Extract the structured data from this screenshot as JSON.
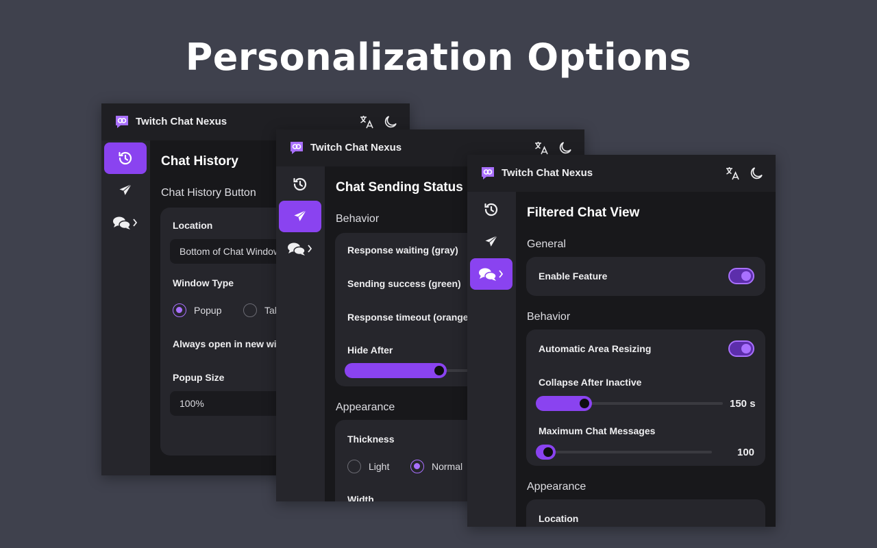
{
  "headline": "Personalization Options",
  "colors": {
    "accent": "#8a43f0",
    "accent_light": "#a970ff",
    "background": "#3f414d",
    "panel": "#18181b"
  },
  "app": {
    "name": "Twitch Chat Nexus",
    "icons": [
      "translate-icon",
      "moon-icon"
    ]
  },
  "sidebar_icons": [
    "history-icon",
    "send-icon",
    "chat-bubbles-icon"
  ],
  "window1": {
    "title": "Chat History",
    "section": "Chat History Button",
    "location_label": "Location",
    "location_value": "Bottom of Chat Window",
    "window_type_label": "Window Type",
    "window_type_options": [
      "Popup",
      "Tab"
    ],
    "window_type_selected": "Popup",
    "always_open_label": "Always open in new window",
    "popup_size_label": "Popup Size",
    "popup_size_value": "100%"
  },
  "window2": {
    "title": "Chat Sending Status",
    "behavior_section": "Behavior",
    "status_items": [
      "Response waiting (gray)",
      "Sending success (green)",
      "Response timeout (orange)"
    ],
    "hide_after_label": "Hide After",
    "hide_after_fraction": 0.55,
    "appearance_section": "Appearance",
    "thickness_label": "Thickness",
    "thickness_options": [
      "Light",
      "Normal"
    ],
    "thickness_selected": "Normal",
    "width_label": "Width"
  },
  "window3": {
    "title": "Filtered Chat View",
    "general_section": "General",
    "enable_feature_label": "Enable Feature",
    "enable_feature_on": true,
    "behavior_section": "Behavior",
    "auto_resize_label": "Automatic Area Resizing",
    "auto_resize_on": true,
    "collapse_label": "Collapse After Inactive",
    "collapse_value": "150 s",
    "collapse_fraction": 0.26,
    "max_messages_label": "Maximum Chat Messages",
    "max_messages_value": "100",
    "max_messages_fraction": 0.07,
    "appearance_section": "Appearance",
    "location_label": "Location"
  }
}
